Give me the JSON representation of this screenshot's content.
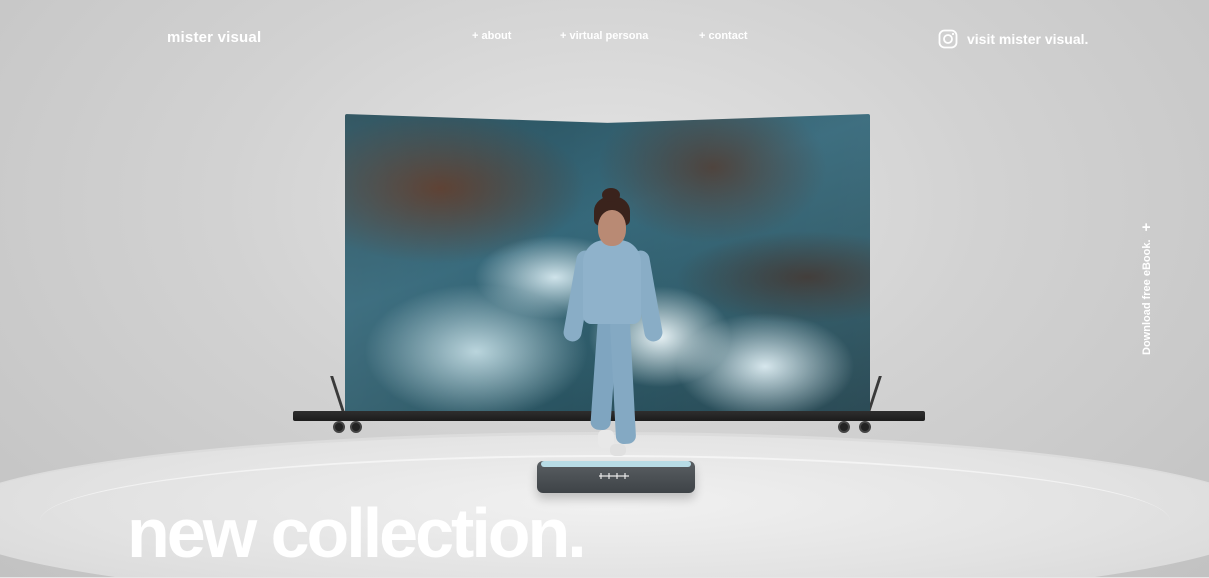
{
  "nav": {
    "brand": "mister visual",
    "links": [
      "+ about",
      "+ virtual persona",
      "+ contact"
    ],
    "instagram_label": "visit mister visual."
  },
  "side_cta": {
    "label": "Download free eBook.",
    "plus": "+"
  },
  "hero": {
    "headline": "new collection."
  },
  "icons": {
    "instagram": "instagram-icon"
  },
  "colors": {
    "text": "#ffffff",
    "background": "#d6d6d6"
  }
}
